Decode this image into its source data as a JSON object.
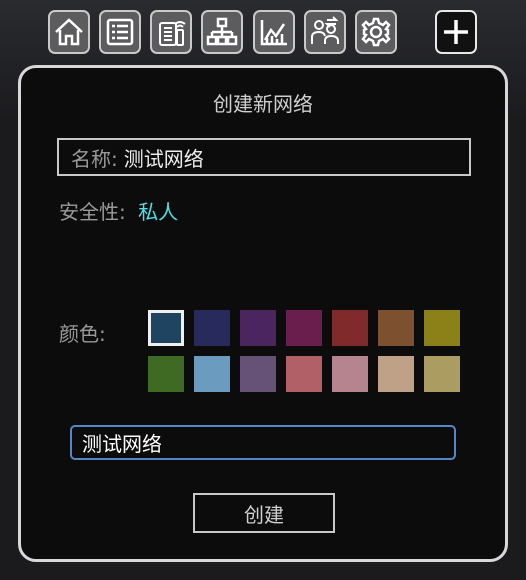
{
  "toolbar": {
    "items": [
      {
        "name": "home-icon"
      },
      {
        "name": "list-icon"
      },
      {
        "name": "network-card-icon"
      },
      {
        "name": "hierarchy-icon"
      },
      {
        "name": "chart-icon"
      },
      {
        "name": "users-swap-icon"
      },
      {
        "name": "gear-icon"
      }
    ],
    "add": {
      "name": "plus-icon"
    }
  },
  "dialog": {
    "title": "创建新网络",
    "name_label": "名称:",
    "name_value": "测试网络",
    "security_label": "安全性:",
    "security_value": "私人",
    "color_label": "颜色:",
    "colors": [
      "#1f4461",
      "#272a5b",
      "#4a2560",
      "#6a1e4e",
      "#802a2c",
      "#7d5130",
      "#8a8118",
      "#3f6a24",
      "#6b9cc0",
      "#665177",
      "#b06066",
      "#b6848f",
      "#bea186",
      "#ab9d62"
    ],
    "selected_color": 0,
    "name_input_value": "测试网络",
    "create_label": "创建"
  }
}
